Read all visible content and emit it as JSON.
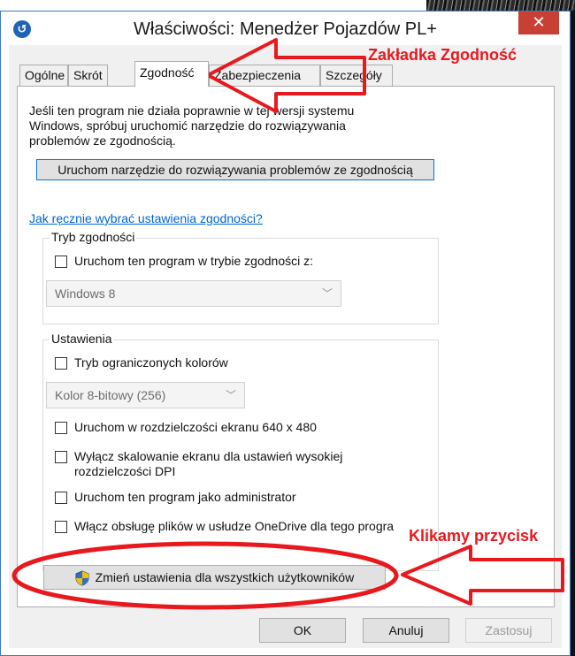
{
  "window": {
    "title": "Właściwości: Menedżer Pojazdów PL+",
    "close_glyph": "✕"
  },
  "tabs": [
    {
      "label": "Ogólne",
      "active": false
    },
    {
      "label": "Skrót",
      "active": false
    },
    {
      "label": "Zgodność",
      "active": true
    },
    {
      "label": "Zabezpieczenia",
      "active": false
    },
    {
      "label": "Szczegóły",
      "active": false
    }
  ],
  "compat": {
    "intro_line1": "Jeśli ten program nie działa poprawnie w tej wersji systemu",
    "intro_line2": "Windows, spróbuj uruchomić narzędzie do rozwiązywania",
    "intro_line3": "problemów ze zgodnością.",
    "troubleshoot_button": "Uruchom narzędzie do rozwiązywania problemów ze zgodnością",
    "manual_link": "Jak ręcznie wybrać ustawienia zgodności?",
    "mode_group_title": "Tryb zgodności",
    "mode_checkbox_label": "Uruchom ten program w trybie zgodności z:",
    "mode_select_value": "Windows 8",
    "settings_group_title": "Ustawienia",
    "reduced_color_label": "Tryb ograniczonych kolorów",
    "color_select_value": "Kolor 8-bitowy (256)",
    "res_640_label": "Uruchom w rozdzielczości ekranu 640 x 480",
    "dpi_label_line1": "Wyłącz skalowanie ekranu dla ustawień wysokiej",
    "dpi_label_line2": "rozdzielczości DPI",
    "admin_label": "Uruchom ten program jako administrator",
    "onedrive_label": "Włącz obsługę plików w usłudze OneDrive dla tego progra",
    "change_all_users_button": "Zmień ustawienia dla wszystkich użytkowników"
  },
  "footer": {
    "ok": "OK",
    "cancel": "Anuluj",
    "apply": "Zastosuj"
  },
  "annotations": {
    "tab_note": "Zakładka Zgodność",
    "button_note": "Klikamy przycisk",
    "color": "#e8191e"
  },
  "icons": [
    "app-icon",
    "close-icon",
    "chevron-down-icon",
    "uac-shield-icon",
    "arrow-annotation",
    "ellipse-annotation"
  ]
}
